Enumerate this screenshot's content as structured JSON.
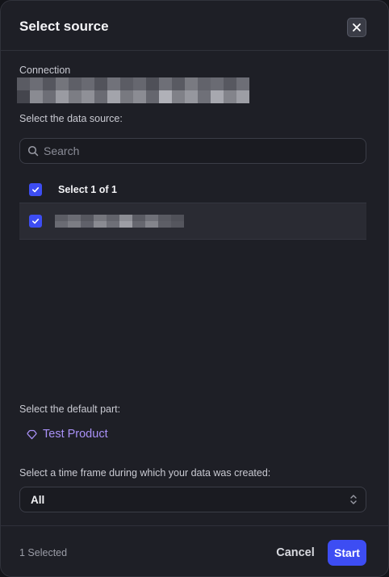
{
  "dialog": {
    "title": "Select source",
    "close_icon": "close-icon"
  },
  "connection": {
    "label": "Connection",
    "value_redacted": true
  },
  "data_source": {
    "label": "Select the data source:",
    "search_placeholder": "Search",
    "search_value": "",
    "select_all_label": "Select 1 of 1",
    "select_all_checked": true,
    "items": [
      {
        "checked": true,
        "name_redacted": true
      }
    ]
  },
  "default_part": {
    "label": "Select the default part:",
    "value": "Test Product",
    "icon": "tag-icon"
  },
  "time_frame": {
    "label": "Select a time frame during which your data was created:",
    "selected": "All"
  },
  "footer": {
    "selected_count": "1 Selected",
    "cancel_label": "Cancel",
    "start_label": "Start"
  },
  "colors": {
    "accent": "#3d4df3",
    "link": "#a991f7",
    "background": "#1e1f26"
  }
}
